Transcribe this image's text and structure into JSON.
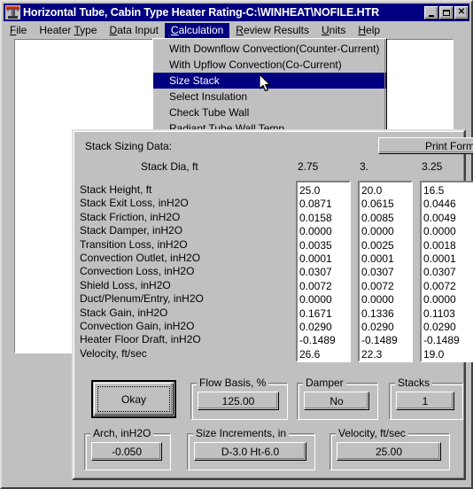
{
  "window": {
    "title": "Horizontal Tube, Cabin Type Heater Rating-C:\\WINHEAT\\NOFILE.HTR",
    "icon": "heater-icon",
    "buttons": {
      "minimize": "_",
      "maximize": "□",
      "close": "✕"
    }
  },
  "menubar": {
    "items": [
      {
        "label": "File",
        "accel": "F",
        "selected": false
      },
      {
        "label": "Heater Type",
        "accel": "T",
        "selected": false
      },
      {
        "label": "Data Input",
        "accel": "D",
        "selected": false
      },
      {
        "label": "Calculation",
        "accel": "C",
        "selected": true
      },
      {
        "label": "Review Results",
        "accel": "R",
        "selected": false
      },
      {
        "label": "Units",
        "accel": "U",
        "selected": false
      },
      {
        "label": "Help",
        "accel": "H",
        "selected": false
      }
    ]
  },
  "dropdown": {
    "items": [
      {
        "label": "With Downflow Convection(Counter-Current)",
        "selected": false
      },
      {
        "label": "With Upflow Convection(Co-Current)",
        "selected": false
      },
      {
        "label": "Size Stack",
        "selected": true
      },
      {
        "label": "Select Insulation",
        "selected": false
      },
      {
        "label": "Check Tube Wall",
        "selected": false
      },
      {
        "label": "Radiant Tube Wall Temp",
        "selected": false
      }
    ]
  },
  "dialog": {
    "title": "Stack Sizing Data:",
    "print_button": "Print Form",
    "okay_button": "Okay",
    "column_header_label": "Stack Dia, ft",
    "columns": [
      "2.75",
      "3.",
      "3.25"
    ],
    "rows": [
      "Stack Height, ft",
      "Stack Exit Loss, inH2O",
      "Stack Friction, inH2O",
      "Stack Damper, inH2O",
      "Transition Loss, inH2O",
      "Convection Outlet, inH2O",
      "Convection Loss, inH2O",
      "Shield Loss, inH2O",
      "Duct/Plenum/Entry, inH2O",
      "Stack Gain, inH2O",
      "Convection Gain, inH2O",
      "Heater Floor Draft, inH2O",
      "Velocity, ft/sec"
    ],
    "values": [
      [
        "25.0",
        "0.0871",
        "0.0158",
        "0.0000",
        "0.0035",
        "0.0001",
        "0.0307",
        "0.0072",
        "0.0000",
        "0.1671",
        "0.0290",
        "-0.1489",
        "26.6"
      ],
      [
        "20.0",
        "0.0615",
        "0.0085",
        "0.0000",
        "0.0025",
        "0.0001",
        "0.0307",
        "0.0072",
        "0.0000",
        "0.1336",
        "0.0290",
        "-0.1489",
        "22.3"
      ],
      [
        "16.5",
        "0.0446",
        "0.0049",
        "0.0000",
        "0.0018",
        "0.0001",
        "0.0307",
        "0.0072",
        "0.0000",
        "0.1103",
        "0.0290",
        "-0.1489",
        "19.0"
      ]
    ],
    "fields": [
      {
        "legend": "Flow Basis, %",
        "value": "125.00"
      },
      {
        "legend": "Damper",
        "value": "No"
      },
      {
        "legend": "Stacks",
        "value": "1"
      },
      {
        "legend": "Arch, inH2O",
        "value": "-0.050"
      },
      {
        "legend": "Size Increments, in",
        "value": "D-3.0 Ht-6.0"
      },
      {
        "legend": "Velocity, ft/sec",
        "value": "25.00"
      }
    ]
  },
  "colors": {
    "titlebar": "#000080",
    "face": "#c0c0c0",
    "highlight": "#000080",
    "client": "#ffffff"
  }
}
